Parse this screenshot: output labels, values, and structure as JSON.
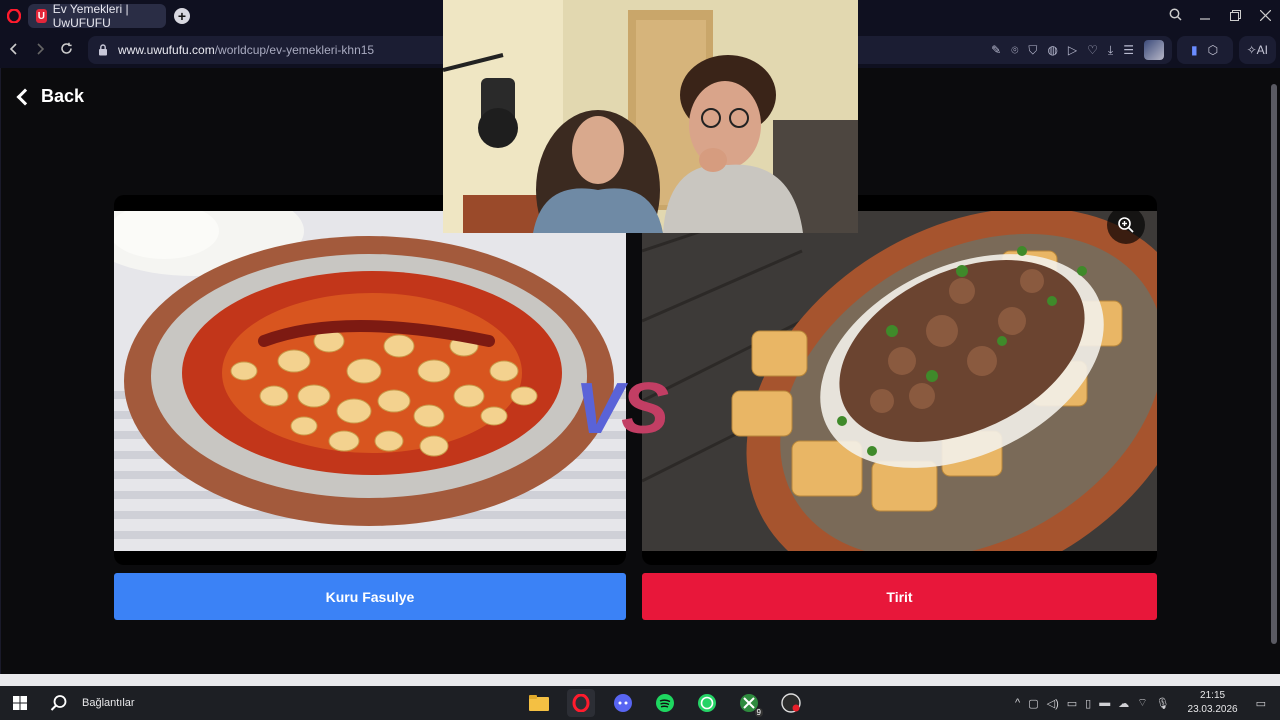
{
  "browser": {
    "tab_title": "Ev Yemekleri | UwUFUFU",
    "tab_favicon_letter": "U",
    "new_tab_symbol": "+",
    "url_host": "www.uwufufu.com",
    "url_path": "/worldcup/ev-yemekleri-khn15",
    "ai_label": "AI"
  },
  "page": {
    "back_label": "Back",
    "vs_v": "V",
    "vs_s": "S",
    "left_choice": {
      "label": "Kuru Fasulye",
      "color": "#3b82f6"
    },
    "right_choice": {
      "label": "Tirit",
      "color": "#e8173a"
    }
  },
  "taskbar": {
    "search_label": "Bağlantılar",
    "xbox_badge": "9",
    "time": "21:15",
    "date": "23.03.2026",
    "apps": [
      "file-explorer-icon",
      "opera-icon",
      "discord-icon",
      "spotify-icon",
      "whatsapp-icon",
      "xbox-icon",
      "obs-icon"
    ]
  }
}
